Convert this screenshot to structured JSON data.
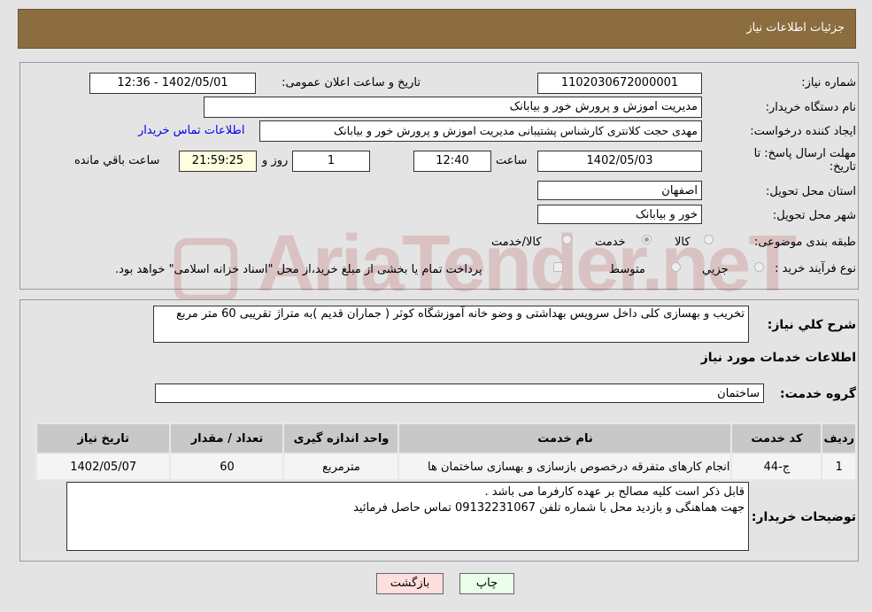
{
  "header": {
    "title": "جزئیات اطلاعات نیاز"
  },
  "fields": {
    "need_number_label": "شماره نیاز:",
    "need_number": "1102030672000001",
    "announce_label": "تاریخ و ساعت اعلان عمومی:",
    "announce_value": "1402/05/01 - 12:36",
    "buyer_label": "نام دستگاه خریدار:",
    "buyer": "مدیریت اموزش و پرورش خور و بیابانک",
    "creator_label": "ایجاد کننده درخواست:",
    "creator": "مهدی حجت کلانتری کارشناس پشتیبانی مدیریت اموزش و پرورش خور و بیابانک",
    "contact_link": "اطلاعات تماس خریدار",
    "deadline_label": "مهلت ارسال پاسخ: تا تاریخ:",
    "deadline_date": "1402/05/03",
    "time_label": "ساعت",
    "deadline_time": "12:40",
    "days": "1",
    "days_label": "روز و",
    "remaining": "21:59:25",
    "remaining_label": "ساعت باقي مانده",
    "province_label": "استان محل تحویل:",
    "province": "اصفهان",
    "city_label": "شهر محل تحویل:",
    "city": "خور و بیابانک",
    "category_label": "طبقه بندی موضوعی:",
    "category_options": [
      "کالا",
      "خدمت",
      "کالا/خدمت"
    ],
    "category_selected": "خدمت",
    "process_label": "نوع فرآیند خرید :",
    "process_options": [
      "جزيي",
      "متوسط"
    ],
    "process_note": "پرداخت تمام یا بخشی از مبلغ خرید،از محل \"اسناد خزانه اسلامی\" خواهد بود.",
    "desc_label": "شرح كلي نياز:",
    "desc": "تخریب و بهسازی کلی داخل سرویس بهداشتی و وضو خانه  آموزشگاه کوثر ( جماران قدیم )به متراژ تقریبی 60 متر مربع",
    "services_title": "اطلاعات خدمات مورد نياز",
    "group_label": "گروه خدمت:",
    "group": "ساختمان"
  },
  "table": {
    "headers": [
      "رديف",
      "کد خدمت",
      "نام خدمت",
      "واحد اندازه گیری",
      "تعداد / مقدار",
      "تاریخ نیاز"
    ],
    "rows": [
      [
        "1",
        "ج-44",
        "انجام کارهای متفرقه درخصوص بازسازی و بهسازی ساختمان ها",
        "مترمربع",
        "60",
        "1402/05/07"
      ]
    ]
  },
  "notes": {
    "label": "توضیحات خریدار:",
    "line1": "قابل ذکر است کلیه مصالح بر عهده کارفرما می باشد .",
    "line2": "جهت هماهنگی و بازدید محل با شماره تلفن 09132231067  تماس حاصل فرمائید"
  },
  "buttons": {
    "print": "چاپ",
    "back": "بازگشت"
  },
  "watermark": "AriaTender.net",
  "colors": {
    "header": "#8c6d40",
    "link": "#0000ee",
    "print_bg": "#eaffea",
    "back_bg": "#ffdede",
    "remaining_bg": "#ffffe0"
  }
}
